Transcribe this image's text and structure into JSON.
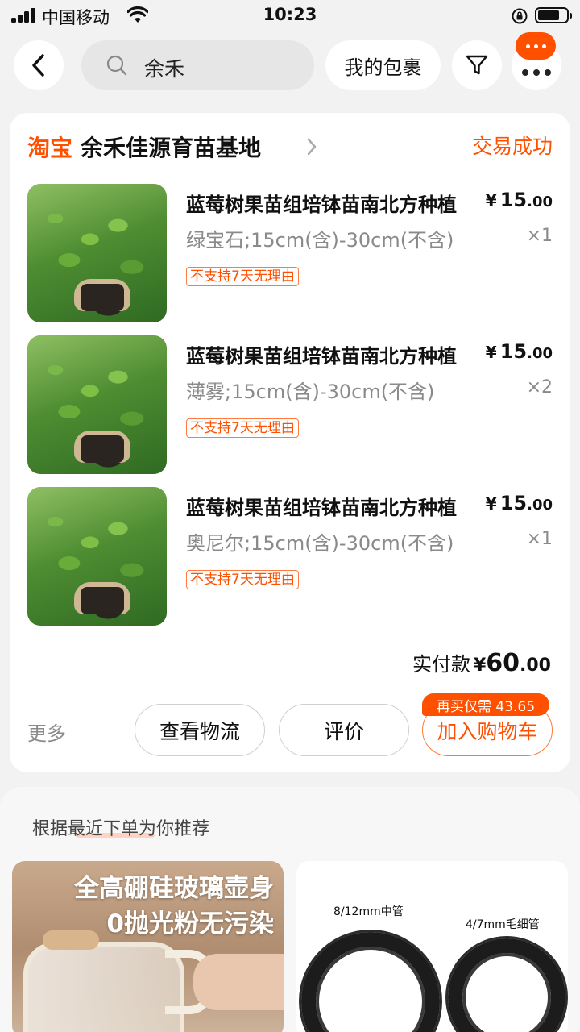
{
  "status_bar": {
    "carrier": "中国移动",
    "time": "10:23"
  },
  "nav": {
    "search_text": "余禾",
    "my_packages": "我的包裹",
    "badge_text": "···"
  },
  "shop": {
    "platform": "淘宝",
    "name": "余禾佳源育苗基地",
    "status": "交易成功"
  },
  "items": [
    {
      "title": "蓝莓树果苗组培钵苗南北方种植",
      "variant": "绿宝石;15cm(含)-30cm(不含)",
      "price_currency": "¥",
      "price_int": "15",
      "price_dec": ".00",
      "qty": "×1",
      "tag": "不支持7天无理由"
    },
    {
      "title": "蓝莓树果苗组培钵苗南北方种植",
      "variant": "薄雾;15cm(含)-30cm(不含)",
      "price_currency": "¥",
      "price_int": "15",
      "price_dec": ".00",
      "qty": "×2",
      "tag": "不支持7天无理由"
    },
    {
      "title": "蓝莓树果苗组培钵苗南北方种植",
      "variant": "奥尼尔;15cm(含)-30cm(不含)",
      "price_currency": "¥",
      "price_int": "15",
      "price_dec": ".00",
      "qty": "×1",
      "tag": "不支持7天无理由"
    }
  ],
  "total": {
    "label": "实付款",
    "currency": "¥",
    "int": "60",
    "dec": ".00"
  },
  "actions": {
    "more": "更多",
    "logistics": "查看物流",
    "review": "评价",
    "add_cart": "加入购物车",
    "rebuy_badge": "再买仅需 43.65"
  },
  "recommend": {
    "title": "根据最近下单为你推荐",
    "card1_line1": "全高硼硅玻璃壶身",
    "card1_line2": "0抛光粉无污染",
    "card2_label_a": "8/12mm中管",
    "card2_label_b": "4/7mm毛细管"
  },
  "colors": {
    "accent": "#ff5000",
    "background": "#f2f2f2"
  }
}
